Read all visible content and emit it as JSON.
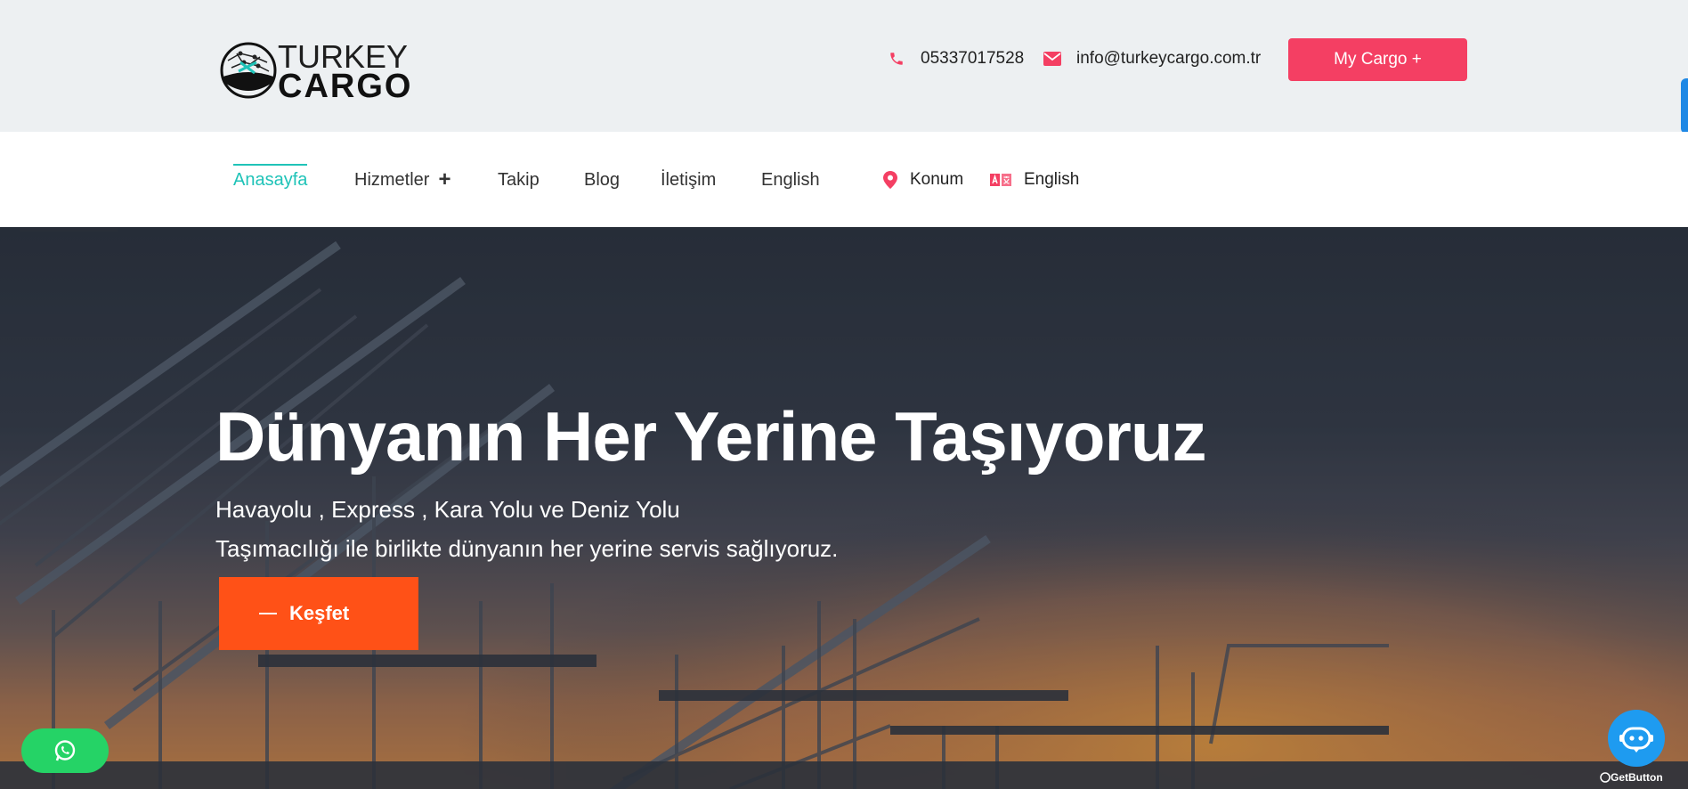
{
  "header": {
    "logo": {
      "line1": "TURKEY",
      "line2": "CARGO"
    },
    "phone": "05337017528",
    "email": "info@turkeycargo.com.tr",
    "cta_label": "My Cargo +"
  },
  "nav": {
    "items": [
      {
        "label": "Anasayfa",
        "active": true
      },
      {
        "label": "Hizmetler",
        "has_submenu": true
      },
      {
        "label": "Takip"
      },
      {
        "label": "Blog"
      },
      {
        "label": "İletişim"
      },
      {
        "label": "English"
      }
    ],
    "location_label": "Konum",
    "language_label": "English"
  },
  "hero": {
    "title": "Dünyanın Her Yerine Taşıyoruz",
    "subtitle_line1": "Havayolu , Express , Kara Yolu ve Deniz Yolu",
    "subtitle_line2": "Taşımacılığı ile birlikte dünyanın her yerine servis sağlıyoruz.",
    "button_label": "Keşfet"
  },
  "floating": {
    "getbutton_label": "GetButton"
  },
  "colors": {
    "accent": "#f43f63",
    "nav_active": "#1fc3b8",
    "hero_button": "#ff5117",
    "whatsapp": "#25d366",
    "bot": "#1e9bf0"
  }
}
